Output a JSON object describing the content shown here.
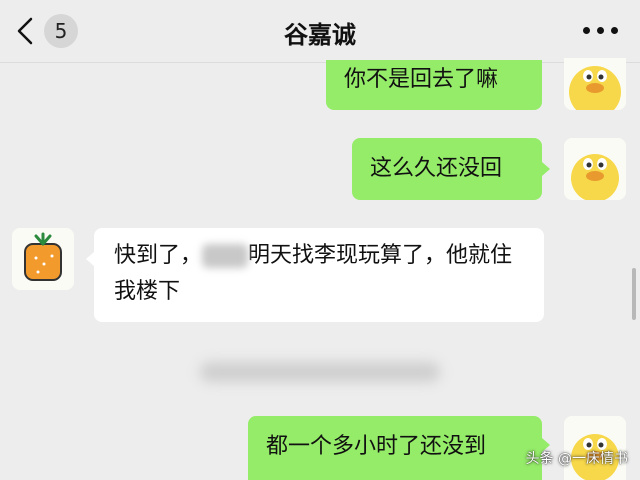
{
  "header": {
    "back_icon": "chevron-left-icon",
    "unread_count": "5",
    "title": "谷嘉诚",
    "more_icon": "more-dots-icon"
  },
  "messages": [
    {
      "from": "me",
      "text": "你不是回去了嘛"
    },
    {
      "from": "me",
      "text": "这么久还没回"
    },
    {
      "from": "other",
      "text_before": "快到了，",
      "text_after": "明天找李现玩算了，他就住我楼下"
    },
    {
      "from": "me",
      "text": "都一个多小时了还没到"
    }
  ],
  "watermark": "头条 @一床情书",
  "colors": {
    "my_bubble": "#95ec69",
    "their_bubble": "#ffffff",
    "background": "#ededed"
  }
}
